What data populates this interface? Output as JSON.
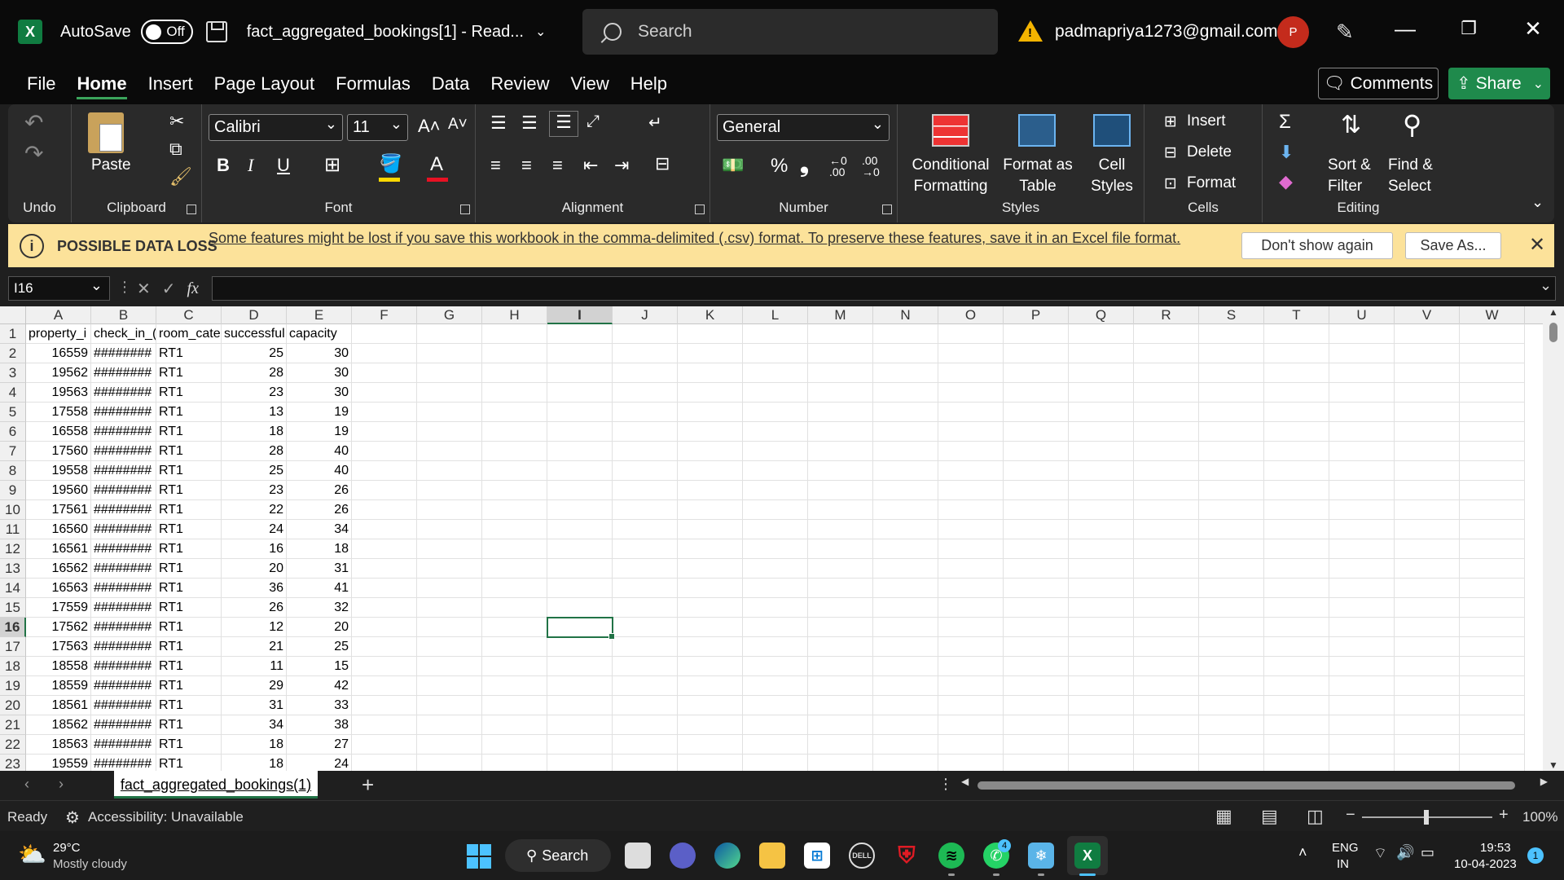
{
  "titlebar": {
    "app_icon": "X",
    "autosave_label": "AutoSave",
    "toggle_state": "Off",
    "filename": "fact_aggregated_bookings[1]  -  Read...",
    "search_placeholder": "Search",
    "user_email": "padmapriya1273@gmail.com",
    "avatar_initial": "P"
  },
  "menu": {
    "items": [
      "File",
      "Home",
      "Insert",
      "Page Layout",
      "Formulas",
      "Data",
      "Review",
      "View",
      "Help"
    ],
    "active": "Home",
    "comments_label": "Comments",
    "share_label": "Share"
  },
  "ribbon": {
    "undo_label": "Undo",
    "clipboard": {
      "label": "Clipboard",
      "paste_label": "Paste"
    },
    "font": {
      "label": "Font",
      "family": "Calibri",
      "size": "11",
      "bold": "B",
      "italic": "I",
      "underline": "U"
    },
    "alignment": {
      "label": "Alignment"
    },
    "number": {
      "label": "Number",
      "format": "General",
      "percent": "%",
      "comma": "❟"
    },
    "styles": {
      "label": "Styles",
      "conditional_1": "Conditional",
      "conditional_2": "Formatting",
      "format_table_1": "Format as",
      "format_table_2": "Table",
      "cell_styles_1": "Cell",
      "cell_styles_2": "Styles"
    },
    "cells": {
      "label": "Cells",
      "insert": "Insert",
      "delete": "Delete",
      "format": "Format"
    },
    "editing": {
      "label": "Editing",
      "sort_1": "Sort &",
      "sort_2": "Filter",
      "find_1": "Find &",
      "find_2": "Select"
    }
  },
  "message_bar": {
    "title": "POSSIBLE DATA LOSS",
    "text": "Some features might be lost if you save this workbook in the comma-delimited (.csv) format. To preserve these features, save it in an Excel file format.",
    "dont_show": "Don't show again",
    "save_as": "Save As..."
  },
  "formula_bar": {
    "name_box": "I16",
    "fx": "fx",
    "content": ""
  },
  "grid": {
    "columns": [
      "A",
      "B",
      "C",
      "D",
      "E",
      "F",
      "G",
      "H",
      "I",
      "J",
      "K",
      "L",
      "M",
      "N",
      "O",
      "P",
      "Q",
      "R",
      "S",
      "T",
      "U",
      "V",
      "W"
    ],
    "selected_column": "I",
    "selected_row": 16,
    "header_row": [
      "property_i",
      "check_in_(",
      "room_cate",
      "successful",
      "capacity"
    ],
    "rows": [
      [
        "16559",
        "########",
        "RT1",
        "25",
        "30"
      ],
      [
        "19562",
        "########",
        "RT1",
        "28",
        "30"
      ],
      [
        "19563",
        "########",
        "RT1",
        "23",
        "30"
      ],
      [
        "17558",
        "########",
        "RT1",
        "13",
        "19"
      ],
      [
        "16558",
        "########",
        "RT1",
        "18",
        "19"
      ],
      [
        "17560",
        "########",
        "RT1",
        "28",
        "40"
      ],
      [
        "19558",
        "########",
        "RT1",
        "25",
        "40"
      ],
      [
        "19560",
        "########",
        "RT1",
        "23",
        "26"
      ],
      [
        "17561",
        "########",
        "RT1",
        "22",
        "26"
      ],
      [
        "16560",
        "########",
        "RT1",
        "24",
        "34"
      ],
      [
        "16561",
        "########",
        "RT1",
        "16",
        "18"
      ],
      [
        "16562",
        "########",
        "RT1",
        "20",
        "31"
      ],
      [
        "16563",
        "########",
        "RT1",
        "36",
        "41"
      ],
      [
        "17559",
        "########",
        "RT1",
        "26",
        "32"
      ],
      [
        "17562",
        "########",
        "RT1",
        "12",
        "20"
      ],
      [
        "17563",
        "########",
        "RT1",
        "21",
        "25"
      ],
      [
        "18558",
        "########",
        "RT1",
        "11",
        "15"
      ],
      [
        "18559",
        "########",
        "RT1",
        "29",
        "42"
      ],
      [
        "18561",
        "########",
        "RT1",
        "31",
        "33"
      ],
      [
        "18562",
        "########",
        "RT1",
        "34",
        "38"
      ],
      [
        "18563",
        "########",
        "RT1",
        "18",
        "27"
      ],
      [
        "19559",
        "########",
        "RT1",
        "18",
        "24"
      ]
    ]
  },
  "sheet_tabs": {
    "active": "fact_aggregated_bookings(1)",
    "add": "+"
  },
  "status": {
    "ready": "Ready",
    "accessibility": "Accessibility: Unavailable",
    "zoom": "100%"
  },
  "taskbar": {
    "weather_temp": "29°C",
    "weather_desc": "Mostly cloudy",
    "search_label": "Search",
    "lang_1": "ENG",
    "lang_2": "IN",
    "time": "19:53",
    "date": "10-04-2023",
    "whatsapp_badge": "4",
    "notification_count": "1"
  }
}
